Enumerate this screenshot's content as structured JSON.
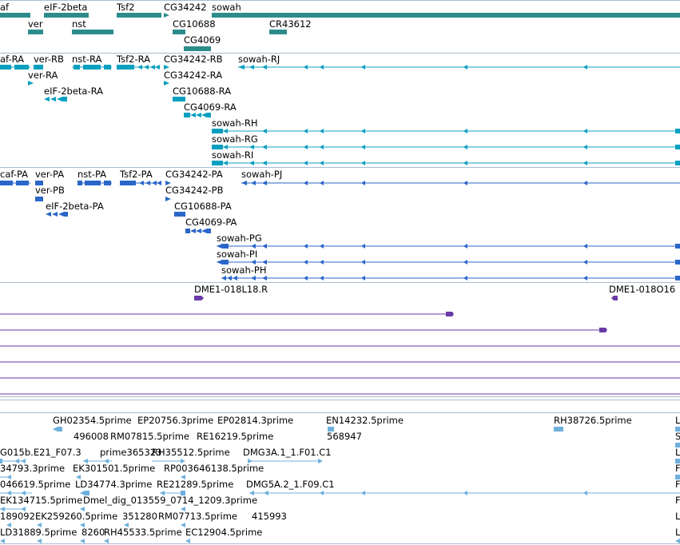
{
  "colors": {
    "gene": "#2c8c8c",
    "transcript": "#0aa0c0",
    "protein": "#2a66c8",
    "clone": "#6a3aa8",
    "est": "#6db0dc",
    "separator": "#a9bcd0"
  },
  "tracks": {
    "genes": {
      "labels": [
        "af",
        "eIF-2beta",
        "Tsf2",
        "CG34242",
        "sowah",
        "ver",
        "nst",
        "CG10688",
        "CR43612",
        "CG4069"
      ]
    },
    "transcripts": {
      "labels": [
        "af-RA",
        "ver-RB",
        "nst-RA",
        "Tsf2-RA",
        "CG34242-RB",
        "sowah-RJ",
        "ver-RA",
        "CG34242-RA",
        "eIF-2beta-RA",
        "CG10688-RA",
        "CG4069-RA",
        "sowah-RH",
        "sowah-RG",
        "sowah-RI"
      ]
    },
    "proteins": {
      "labels": [
        "caf-PA",
        "ver-PA",
        "nst-PA",
        "Tsf2-PA",
        "CG34242-PA",
        "sowah-PJ",
        "ver-PB",
        "CG34242-PB",
        "eIF-2beta-PA",
        "CG10688-PA",
        "CG4069-PA",
        "sowah-PG",
        "sowah-PI",
        "sowah-PH"
      ]
    },
    "clones": {
      "labels": [
        "DME1-018L18.R",
        "DME1-018O16"
      ]
    },
    "ests": {
      "labels": [
        "GH02354.5prime",
        "EP20756.3prime",
        "EP02814.3prime",
        "EN14232.5prime",
        "RH38726.5prime",
        "L",
        "496008",
        "RM07815.5prime",
        "RE16219.5prime",
        "568947",
        "S",
        "G015b.E21_F07.3",
        "prime365323",
        "RH35512.5prime",
        "DMG3A.1_1.F01.C1",
        "L",
        "34793.3prime",
        "EK301501.5prime",
        "RP003646138.5prime",
        "F",
        "046619.5prime",
        "LD34774.3prime",
        "RE21289.5prime",
        "DMG5A.2_1.F09.C1",
        "F",
        "EK134715.5prime",
        "Dmel_dig_013559_0714_1209.3prime",
        "F",
        "189092",
        "EK259260.5prime",
        "351280",
        "RM07713.5prime",
        "415993",
        "L",
        "LD31889.5prime",
        "8260",
        "RH45533.5prime",
        "EC12904.5prime",
        "L"
      ]
    }
  }
}
